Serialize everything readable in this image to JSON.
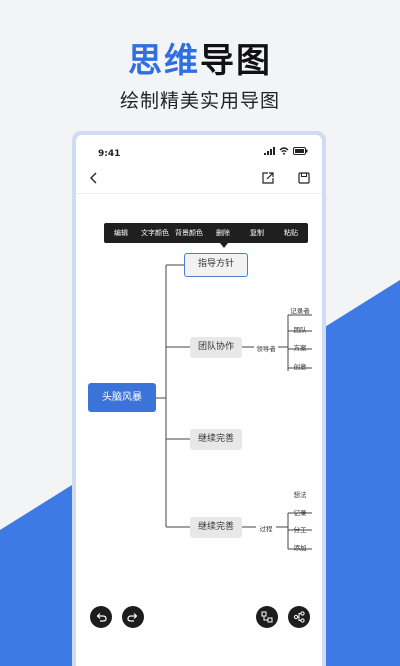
{
  "promo": {
    "title_accent": "思维",
    "title_rest": "导图",
    "subtitle": "绘制精美实用导图"
  },
  "status_bar": {
    "time": "9:41"
  },
  "context_menu": {
    "items": [
      "编辑",
      "文字颜色",
      "背景颜色",
      "删除",
      "复制",
      "粘贴"
    ]
  },
  "mindmap": {
    "root": "头脑风暴",
    "branches": [
      {
        "label": "指导方针"
      },
      {
        "label": "团队协作",
        "mid": "领导者",
        "leaves": [
          "记录者",
          "团队",
          "方案",
          "创意"
        ]
      },
      {
        "label": "继续完善"
      },
      {
        "label": "继续完善",
        "mid": "过程",
        "leaves": [
          "想法",
          "记录",
          "分工",
          "添加"
        ]
      }
    ]
  },
  "icons": {
    "back": "chevron-left-icon",
    "share": "share-icon",
    "save": "save-icon",
    "undo": "undo-icon",
    "redo": "redo-icon",
    "add-node": "add-node-icon",
    "branch": "branch-icon"
  },
  "colors": {
    "accent": "#2f6fe0",
    "root_node": "#3b74d9",
    "menu_bg": "#1f1f1f",
    "selection_border": "#4a80c9"
  }
}
